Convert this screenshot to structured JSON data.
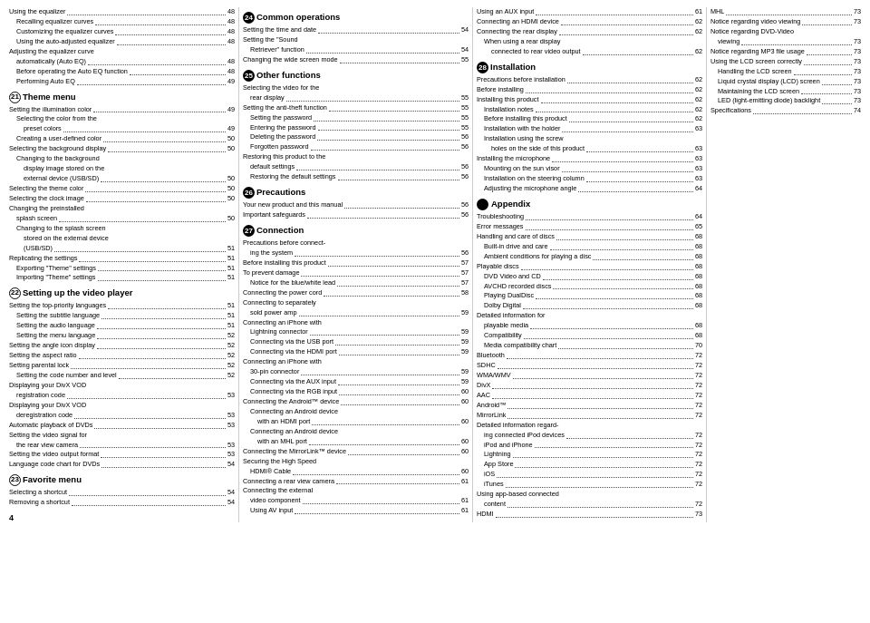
{
  "col1": {
    "sections": [
      {
        "number": "21",
        "filled": false,
        "title": "Theme menu",
        "items": [
          {
            "label": "Setting the illumination color",
            "page": "49",
            "indent": 0
          },
          {
            "label": "Selecting the color from the",
            "page": "",
            "indent": 1
          },
          {
            "label": "preset colors",
            "page": "49",
            "indent": 2
          },
          {
            "label": "Creating a user-defined color",
            "page": "50",
            "indent": 1
          },
          {
            "label": "Selecting the background display",
            "page": "50",
            "indent": 0
          },
          {
            "label": "Changing to the background",
            "page": "",
            "indent": 1
          },
          {
            "label": "display image stored on the",
            "page": "",
            "indent": 2
          },
          {
            "label": "external device (USB/SD)",
            "page": "50",
            "indent": 2
          },
          {
            "label": "Selecting the theme color",
            "page": "50",
            "indent": 0
          },
          {
            "label": "Selecting the clock image",
            "page": "50",
            "indent": 0
          },
          {
            "label": "Changing the preinstalled",
            "page": "",
            "indent": 0
          },
          {
            "label": "splash screen",
            "page": "50",
            "indent": 1
          },
          {
            "label": "Changing to the splash screen",
            "page": "",
            "indent": 1
          },
          {
            "label": "stored on the external device",
            "page": "",
            "indent": 2
          },
          {
            "label": "(USB/SD)",
            "page": "51",
            "indent": 2
          },
          {
            "label": "Replicating the settings",
            "page": "51",
            "indent": 0
          },
          {
            "label": "Exporting \"Theme\" settings",
            "page": "51",
            "indent": 1
          },
          {
            "label": "Importing \"Theme\" settings",
            "page": "51",
            "indent": 1
          }
        ]
      },
      {
        "number": "22",
        "filled": false,
        "title": "Setting up the video player",
        "items": [
          {
            "label": "Setting the top-priority languages",
            "page": "51",
            "indent": 0
          },
          {
            "label": "Setting the subtitle language",
            "page": "51",
            "indent": 1
          },
          {
            "label": "Setting the audio language",
            "page": "51",
            "indent": 1
          },
          {
            "label": "Setting the menu language",
            "page": "52",
            "indent": 1
          },
          {
            "label": "Setting the angle icon display",
            "page": "52",
            "indent": 0
          },
          {
            "label": "Setting the aspect ratio",
            "page": "52",
            "indent": 0
          },
          {
            "label": "Setting parental lock",
            "page": "52",
            "indent": 0
          },
          {
            "label": "Setting the code number and level",
            "page": "52",
            "indent": 1
          },
          {
            "label": "Displaying your DivX VOD",
            "page": "",
            "indent": 0
          },
          {
            "label": "registration code",
            "page": "53",
            "indent": 1
          },
          {
            "label": "Displaying your DivX VOD",
            "page": "",
            "indent": 0
          },
          {
            "label": "deregistration code",
            "page": "53",
            "indent": 1
          },
          {
            "label": "Automatic playback of DVDs",
            "page": "53",
            "indent": 0
          },
          {
            "label": "Setting the video signal for",
            "page": "",
            "indent": 0
          },
          {
            "label": "the rear view camera",
            "page": "53",
            "indent": 1
          },
          {
            "label": "Setting the video output format",
            "page": "53",
            "indent": 0
          },
          {
            "label": "Language code chart for DVDs",
            "page": "54",
            "indent": 0
          }
        ]
      },
      {
        "number": "23",
        "filled": false,
        "title": "Favorite menu",
        "items": [
          {
            "label": "Selecting a shortcut",
            "page": "54",
            "indent": 0
          },
          {
            "label": "Removing a shortcut",
            "page": "54",
            "indent": 0
          }
        ]
      }
    ],
    "preface": [
      {
        "label": "Using the equalizer",
        "page": "48",
        "indent": 0
      },
      {
        "label": "Recalling equalizer curves",
        "page": "48",
        "indent": 1
      },
      {
        "label": "Customizing the equalizer curves",
        "page": "48",
        "indent": 1
      },
      {
        "label": "Using the auto-adjusted equalizer",
        "page": "48",
        "indent": 1
      },
      {
        "label": "Adjusting the equalizer curve",
        "page": "",
        "indent": 0
      },
      {
        "label": "automatically (Auto EQ)",
        "page": "48",
        "indent": 1
      },
      {
        "label": "Before operating the Auto EQ function",
        "page": "48",
        "indent": 1
      },
      {
        "label": "Performing Auto EQ",
        "page": "49",
        "indent": 1
      }
    ],
    "page_num": "4"
  },
  "col2": {
    "sections": [
      {
        "number": "24",
        "filled": true,
        "title": "Common operations",
        "items": [
          {
            "label": "Setting the time and date",
            "page": "54",
            "indent": 0
          },
          {
            "label": "Setting the \"Sound",
            "page": "",
            "indent": 0
          },
          {
            "label": "Retriever\" function",
            "page": "54",
            "indent": 1
          },
          {
            "label": "Changing the wide screen mode",
            "page": "55",
            "indent": 0
          }
        ]
      },
      {
        "number": "25",
        "filled": true,
        "title": "Other functions",
        "items": [
          {
            "label": "Selecting the video for the",
            "page": "",
            "indent": 0
          },
          {
            "label": "rear display",
            "page": "55",
            "indent": 1
          },
          {
            "label": "Setting the anti-theft function",
            "page": "55",
            "indent": 0
          },
          {
            "label": "Setting the password",
            "page": "55",
            "indent": 1
          },
          {
            "label": "Entering the password",
            "page": "55",
            "indent": 1
          },
          {
            "label": "Deleting the password",
            "page": "56",
            "indent": 1
          },
          {
            "label": "Forgotten password",
            "page": "56",
            "indent": 1
          },
          {
            "label": "Restoring this product to the",
            "page": "",
            "indent": 0
          },
          {
            "label": "default settings",
            "page": "56",
            "indent": 1
          },
          {
            "label": "Restoring the default settings",
            "page": "56",
            "indent": 1
          }
        ]
      },
      {
        "number": "26",
        "filled": true,
        "title": "Precautions",
        "items": [
          {
            "label": "Your new product and this manual",
            "page": "56",
            "indent": 0
          },
          {
            "label": "Important safeguards",
            "page": "56",
            "indent": 0
          }
        ]
      },
      {
        "number": "27",
        "filled": true,
        "title": "Connection",
        "items": [
          {
            "label": "Precautions before connect-",
            "page": "",
            "indent": 0
          },
          {
            "label": "ing the system",
            "page": "56",
            "indent": 1
          },
          {
            "label": "Before installing this product",
            "page": "57",
            "indent": 0
          },
          {
            "label": "To prevent damage",
            "page": "57",
            "indent": 0
          },
          {
            "label": "Notice for the blue/white lead",
            "page": "57",
            "indent": 1
          },
          {
            "label": "Connecting the power cord",
            "page": "58",
            "indent": 0
          },
          {
            "label": "Connecting to separately",
            "page": "",
            "indent": 0
          },
          {
            "label": "sold power amp",
            "page": "59",
            "indent": 1
          },
          {
            "label": "Connecting an iPhone with",
            "page": "",
            "indent": 0
          },
          {
            "label": "Lightning connector",
            "page": "59",
            "indent": 1
          },
          {
            "label": "Connecting via the USB port",
            "page": "59",
            "indent": 1
          },
          {
            "label": "Connecting via the HDMI port",
            "page": "59",
            "indent": 1
          },
          {
            "label": "Connecting an iPhone with",
            "page": "",
            "indent": 0
          },
          {
            "label": "30-pin connector",
            "page": "59",
            "indent": 1
          },
          {
            "label": "Connecting via the AUX input",
            "page": "59",
            "indent": 1
          },
          {
            "label": "Connecting via the RGB input",
            "page": "60",
            "indent": 1
          },
          {
            "label": "Connecting the Android™ device",
            "page": "60",
            "indent": 0
          },
          {
            "label": "Connecting an Android device",
            "page": "",
            "indent": 1
          },
          {
            "label": "with an HDMI port",
            "page": "60",
            "indent": 2
          },
          {
            "label": "Connecting an Android device",
            "page": "",
            "indent": 1
          },
          {
            "label": "with an MHL port",
            "page": "60",
            "indent": 2
          },
          {
            "label": "Connecting the MirrorLink™ device",
            "page": "60",
            "indent": 0
          },
          {
            "label": "Securing the High Speed",
            "page": "",
            "indent": 0
          },
          {
            "label": "HDMI® Cable",
            "page": "60",
            "indent": 1
          },
          {
            "label": "Connecting a rear view camera",
            "page": "61",
            "indent": 0
          },
          {
            "label": "Connecting the external",
            "page": "",
            "indent": 0
          },
          {
            "label": "video component",
            "page": "61",
            "indent": 1
          },
          {
            "label": "Using AV input",
            "page": "61",
            "indent": 1
          }
        ]
      }
    ]
  },
  "col3": {
    "sections": [
      {
        "number": "28",
        "filled": true,
        "title": "Installation",
        "items": [
          {
            "label": "Precautions before installation",
            "page": "62",
            "indent": 0
          },
          {
            "label": "Before installing",
            "page": "62",
            "indent": 0
          },
          {
            "label": "Installing this product",
            "page": "62",
            "indent": 0
          },
          {
            "label": "Installation notes",
            "page": "62",
            "indent": 1
          },
          {
            "label": "Before installing this product",
            "page": "62",
            "indent": 1
          },
          {
            "label": "Installation with the holder",
            "page": "63",
            "indent": 1
          },
          {
            "label": "Installation using the screw",
            "page": "",
            "indent": 1
          },
          {
            "label": "holes on the side of this product",
            "page": "63",
            "indent": 2
          },
          {
            "label": "Installing the microphone",
            "page": "63",
            "indent": 0
          },
          {
            "label": "Mounting on the sun visor",
            "page": "63",
            "indent": 1
          },
          {
            "label": "Installation on the steering column",
            "page": "63",
            "indent": 1
          },
          {
            "label": "Adjusting the microphone angle",
            "page": "64",
            "indent": 1
          }
        ]
      },
      {
        "number": "appendix",
        "filled": true,
        "title": "Appendix",
        "items": [
          {
            "label": "Troubleshooting",
            "page": "64",
            "indent": 0
          },
          {
            "label": "Error messages",
            "page": "65",
            "indent": 0
          },
          {
            "label": "Handling and care of discs",
            "page": "68",
            "indent": 0
          },
          {
            "label": "Built-in drive and care",
            "page": "68",
            "indent": 1
          },
          {
            "label": "Ambient conditions for playing a disc",
            "page": "68",
            "indent": 1
          },
          {
            "label": "Playable discs",
            "page": "68",
            "indent": 0
          },
          {
            "label": "DVD Video and CD",
            "page": "68",
            "indent": 1
          },
          {
            "label": "AVCHD recorded discs",
            "page": "68",
            "indent": 1
          },
          {
            "label": "Playing DualDisc",
            "page": "68",
            "indent": 1
          },
          {
            "label": "Dolby Digital",
            "page": "68",
            "indent": 1
          },
          {
            "label": "Detailed information for",
            "page": "",
            "indent": 0
          },
          {
            "label": "playable media",
            "page": "68",
            "indent": 1
          },
          {
            "label": "Compatibility",
            "page": "68",
            "indent": 1
          },
          {
            "label": "Media compatibility chart",
            "page": "70",
            "indent": 1
          },
          {
            "label": "Bluetooth",
            "page": "72",
            "indent": 0
          },
          {
            "label": "SDHC",
            "page": "72",
            "indent": 0
          },
          {
            "label": "WMA/WMV",
            "page": "72",
            "indent": 0
          },
          {
            "label": "DivX",
            "page": "72",
            "indent": 0
          },
          {
            "label": "AAC",
            "page": "72",
            "indent": 0
          },
          {
            "label": "Android™",
            "page": "72",
            "indent": 0
          },
          {
            "label": "MirrorLink",
            "page": "72",
            "indent": 0
          },
          {
            "label": "Detailed information regard-",
            "page": "",
            "indent": 0
          },
          {
            "label": "ing connected iPod devices",
            "page": "72",
            "indent": 1
          },
          {
            "label": "iPod and iPhone",
            "page": "72",
            "indent": 1
          },
          {
            "label": "Lightning",
            "page": "72",
            "indent": 1
          },
          {
            "label": "App Store",
            "page": "72",
            "indent": 1
          },
          {
            "label": "iOS",
            "page": "72",
            "indent": 1
          },
          {
            "label": "iTunes",
            "page": "72",
            "indent": 1
          },
          {
            "label": "Using app-based connected",
            "page": "",
            "indent": 0
          },
          {
            "label": "content",
            "page": "72",
            "indent": 1
          },
          {
            "label": "HDMI",
            "page": "73",
            "indent": 0
          }
        ]
      }
    ],
    "preface": [
      {
        "label": "Using an AUX input",
        "page": "61",
        "indent": 0
      },
      {
        "label": "Connecting an HDMI device",
        "page": "62",
        "indent": 0
      },
      {
        "label": "Connecting the rear display",
        "page": "62",
        "indent": 0
      },
      {
        "label": "When using a rear display",
        "page": "",
        "indent": 1
      },
      {
        "label": "connected to rear video output",
        "page": "62",
        "indent": 2
      }
    ]
  },
  "col4": {
    "items": [
      {
        "label": "MHL",
        "page": "73",
        "indent": 0
      },
      {
        "label": "Notice regarding video viewing",
        "page": "73",
        "indent": 0
      },
      {
        "label": "Notice regarding DVD-Video",
        "page": "",
        "indent": 0
      },
      {
        "label": "viewing",
        "page": "73",
        "indent": 1
      },
      {
        "label": "Notice regarding MP3 file usage",
        "page": "73",
        "indent": 0
      },
      {
        "label": "Using the LCD screen correctly",
        "page": "73",
        "indent": 0
      },
      {
        "label": "Handling the LCD screen",
        "page": "73",
        "indent": 1
      },
      {
        "label": "Liquid crystal display (LCD) screen",
        "page": "73",
        "indent": 1
      },
      {
        "label": "Maintaining the LCD screen",
        "page": "73",
        "indent": 1
      },
      {
        "label": "LED (light-emitting diode) backlight",
        "page": "73",
        "indent": 1
      },
      {
        "label": "Specifications",
        "page": "74",
        "indent": 0
      }
    ]
  }
}
